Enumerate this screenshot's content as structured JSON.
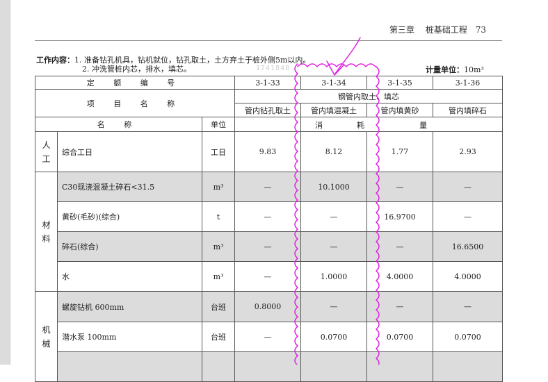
{
  "header": {
    "chapter": "第三章",
    "section": "桩基础工程",
    "page": "73"
  },
  "work": {
    "label": "工作内容：",
    "line1": "1. 准备钻孔机具，钻机就位，钻孔取土，土方弃土于桩外侧5m以内。",
    "line2": "2. 冲洗管桩内芯，排水，填芯。"
  },
  "unit": {
    "label": "计量单位：",
    "value": "10m³"
  },
  "watermark": "1741848",
  "table": {
    "quota_label": "定 额 编 号",
    "codes": [
      "3-1-33",
      "3-1-34",
      "3-1-35",
      "3-1-36"
    ],
    "item_label": "项 目 名 称",
    "group_title": "钢管内取土、填芯",
    "items": [
      "管内钻孔取土",
      "管内填混凝土",
      "管内填黄砂",
      "管内填碎石"
    ],
    "name_header": "名 称",
    "unit_header": "单位",
    "consumption_header": [
      "消",
      "耗",
      "量"
    ],
    "groups": [
      {
        "category": [
          "人",
          "工"
        ],
        "rows": [
          {
            "name": "综合工日",
            "unit": "工日",
            "values": [
              "9.83",
              "8.12",
              "1.77",
              "2.93"
            ]
          }
        ]
      },
      {
        "category": [
          "材",
          "料"
        ],
        "rows": [
          {
            "name": "C30现浇混凝土碎石<31.5",
            "unit": "m³",
            "values": [
              "—",
              "10.1000",
              "—",
              "—"
            ]
          },
          {
            "name": "黄砂(毛砂)(综合)",
            "unit": "t",
            "values": [
              "—",
              "—",
              "16.9700",
              "—"
            ]
          },
          {
            "name": "碎石(综合)",
            "unit": "m³",
            "values": [
              "—",
              "—",
              "—",
              "16.6500"
            ]
          },
          {
            "name": "水",
            "unit": "m³",
            "values": [
              "—",
              "1.0000",
              "4.0000",
              "4.0000"
            ]
          }
        ]
      },
      {
        "category": [
          "机",
          "械"
        ],
        "rows": [
          {
            "name": "螺旋钻机 600mm",
            "unit": "台班",
            "values": [
              "0.8000",
              "—",
              "—",
              "—"
            ]
          },
          {
            "name": "潜水泵 100mm",
            "unit": "台班",
            "values": [
              "—",
              "0.0700",
              "0.0700",
              "0.0700"
            ]
          },
          {
            "name": "",
            "unit": "",
            "values": [
              "",
              "",
              "",
              ""
            ]
          }
        ]
      }
    ]
  },
  "annotation_color": "#e020e0"
}
